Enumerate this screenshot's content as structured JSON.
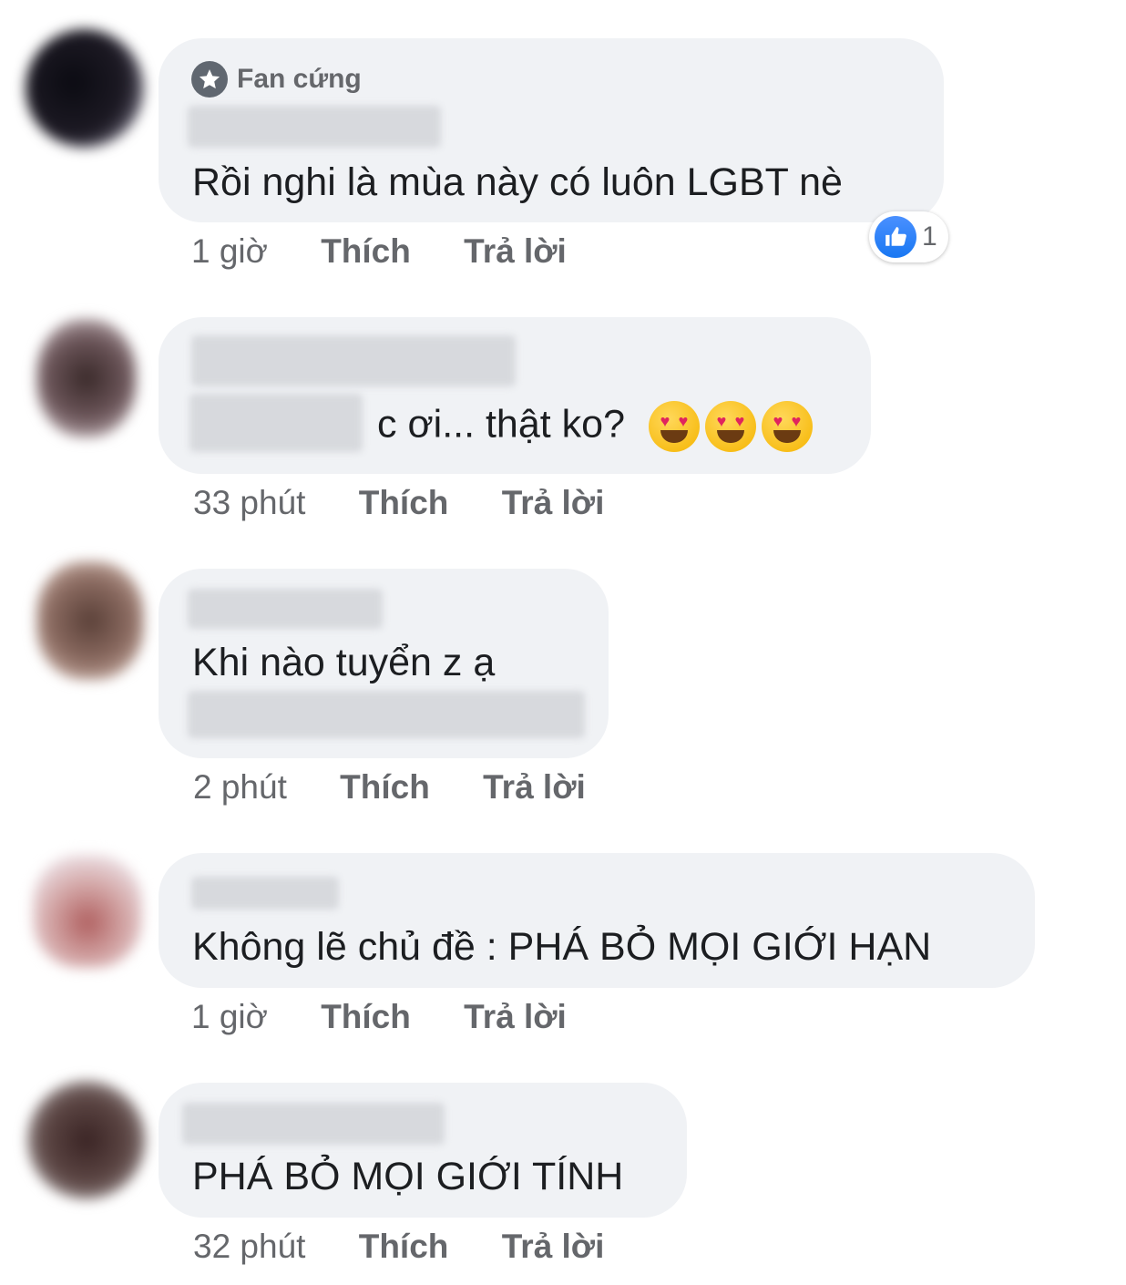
{
  "comments": [
    {
      "badge": "Fan cứng",
      "text": "Rồi nghi là mùa này có luôn LGBT nè",
      "time": "1 giờ",
      "like_label": "Thích",
      "reply_label": "Trả lời",
      "reaction_count": "1"
    },
    {
      "text": "c ơi... thật ko?",
      "emoji": [
        "smiling-face-with-heart-eyes",
        "smiling-face-with-heart-eyes",
        "smiling-face-with-heart-eyes"
      ],
      "time": "33 phút",
      "like_label": "Thích",
      "reply_label": "Trả lời"
    },
    {
      "text": "Khi nào tuyển z ạ",
      "time": "2 phút",
      "like_label": "Thích",
      "reply_label": "Trả lời"
    },
    {
      "text": "Không lẽ chủ đề : PHÁ BỎ MỌI GIỚI HẠN",
      "time": "1 giờ",
      "like_label": "Thích",
      "reply_label": "Trả lời"
    },
    {
      "text": "PHÁ BỎ MỌI GIỚI TÍNH",
      "time": "32 phút",
      "like_label": "Thích",
      "reply_label": "Trả lời"
    }
  ],
  "colors": {
    "bubble": "#f0f2f5",
    "meta": "#65676b",
    "like_blue": "#1877f2"
  }
}
